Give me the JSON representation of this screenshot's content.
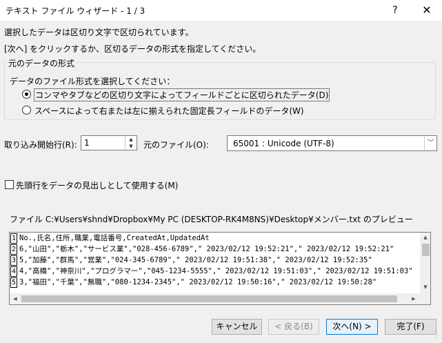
{
  "window": {
    "title": "テキスト ファイル ウィザード - 1 / 3",
    "help_label": "?",
    "close_label": "✕"
  },
  "instructions": {
    "line1": "選択したデータは区切り文字で区切られています。",
    "line2": "[次へ] をクリックするか、区切るデータの形式を指定してください。"
  },
  "format_group": {
    "legend": "元のデータの形式",
    "prompt": "データのファイル形式を選択してください：",
    "options": [
      {
        "label": "コンマやタブなどの区切り文字によってフィールドごとに区切られたデータ(D)",
        "checked": true
      },
      {
        "label": "スペースによって右または左に揃えられた固定長フィールドのデータ(W)",
        "checked": false
      }
    ]
  },
  "start_row": {
    "label": "取り込み開始行(R):",
    "value": "1"
  },
  "origin": {
    "label": "元のファイル(O):",
    "value": "65001 : Unicode (UTF-8)"
  },
  "header_checkbox": {
    "label": "先頭行をデータの見出しとして使用する(M)",
    "checked": false
  },
  "preview": {
    "label": "ファイル C:¥Users¥shnd¥Dropbox¥My PC (DESKTOP-RK4M8NS)¥Desktop¥メンバー.txt のプレビュー",
    "rows": [
      {
        "num": "1",
        "text": "No.,氏名,住所,職業,電話番号,CreatedAt,UpdatedAt"
      },
      {
        "num": "2",
        "text": "6,\"山田\",\"栃木\",\"サービス業\",\"028-456-6789\",\" 2023/02/12 19:52:21\",\" 2023/02/12 19:52:21\""
      },
      {
        "num": "3",
        "text": "5,\"加藤\",\"群馬\",\"営業\",\"024-345-6789\",\" 2023/02/12 19:51:38\",\" 2023/02/12 19:52:35\""
      },
      {
        "num": "4",
        "text": "4,\"高橋\",\"神奈川\",\"プログラマー\",\"045-1234-5555\",\" 2023/02/12 19:51:03\",\" 2023/02/12 19:51:03\""
      },
      {
        "num": "5",
        "text": "3,\"福田\",\"千葉\",\"無職\",\"080-1234-2345\",\" 2023/02/12 19:50:16\",\" 2023/02/12 19:50:28\""
      }
    ]
  },
  "buttons": {
    "cancel": "キャンセル",
    "back": "< 戻る(B)",
    "next": "次へ(N) >",
    "finish": "完了(F)"
  }
}
